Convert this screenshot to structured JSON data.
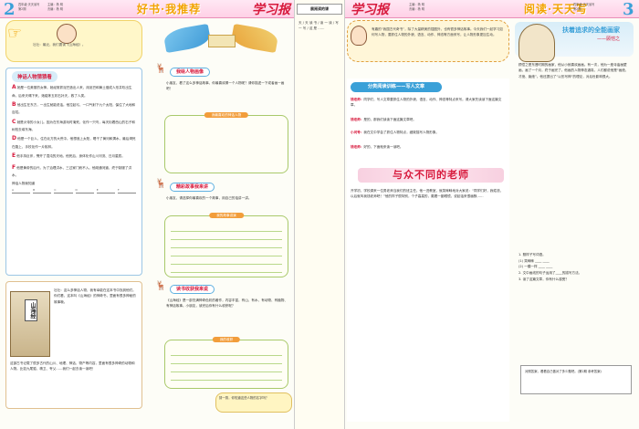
{
  "left_page": {
    "page_number": "2",
    "meta": [
      "四年级·天天读写",
      "第2期"
    ],
    "meta2": [
      "主编：杨 明",
      "责编：杨 明"
    ],
    "banner": "好书·我推荐",
    "logo": "学习报",
    "speech": "壮壮：最近，我们要读《山海经》。",
    "story_section": {
      "title": "神话人物猜猜看",
      "paragraphs": [
        {
          "lead": "A",
          "text": "她是一位美丽的女神。她经常抓泥巴造出人来，用泥巴和黄土做成人形并吹出生命。后来天塌下来，她熔炼五彩石补天，救了人类。"
        },
        {
          "lead": "B",
          "text": "他出生在东方，一出生就能说话。他拉起弓，一口气射下九个太阳，保住了大地和百姓。"
        },
        {
          "lead": "C",
          "text": "她是炎帝的小女儿。因为在东海游玩时淹死，化作一只鸟，每天衔着西山的石子和树枝去填东海。"
        },
        {
          "lead": "D",
          "text": "他是一个巨人，住在北方的大荒中。他想追上太阳，喝干了黄河和渭水，最后渴死在路上，手杖化作一片桃林。"
        },
        {
          "lead": "E",
          "text": "他手持巨斧，劈开了混沌的天地。他死后，身体化作山川河流、日月星辰。"
        },
        {
          "lead": "F",
          "text": "他是黄帝的后代，为了治理洪水，三过家门而不入。他疏通河道，终于制服了洪水。"
        }
      ],
      "summary_label": "神话人物我知道",
      "blanks": [
        "A",
        "B",
        "C",
        "D",
        "E",
        "F"
      ]
    },
    "book_section": {
      "book_title": "山海经",
      "text": "壮壮：这么多神话人物，我有幸能在这本书中找到他们。你们看，这本叫《山海经》的神奇书，里面有很多神秘的故事哦。",
      "text2": "这部古书记载了很多古代的山川、地理、神话、物产等内容，里面有很多神奇的动物和人物。比如九尾狐、精卫、夸父……我们一起去读一读吧！"
    },
    "draw_section": {
      "title": "我绘人物画像",
      "text": "小朋友，看了这么多神话故事，你最喜欢哪一个人物呢？请你描述一下或者画一画吧！",
      "frame_title": "我最喜欢的神话人物"
    },
    "story_tell": {
      "title": "精彩故事我来讲",
      "text": "小朋友，请选择你最喜欢的一个故事，用自己的话讲一讲。",
      "frame_title": "我的故事讲演"
    },
    "note_section": {
      "title": "读书收获我来说",
      "text": "《山海经》是一部充满神奇色彩的著作，内容丰富，有山、有水、有动物、有植物、有神话故事。小朋友，读完后你有什么收获呢？",
      "frame_title": "我的收获"
    },
    "girl_note": "猜一猜，你知道这些人物的名字吗？"
  },
  "gutter": {
    "title": "展阅读的课",
    "text": "天 / 天 读 书 / 读 一 读 / 写 一 写 / 这 是 ……"
  },
  "right_page": {
    "page_number": "3",
    "meta": [
      "四年级·天天读写",
      "第2期"
    ],
    "meta2": [
      "主编：杨 明",
      "责编：杨 明"
    ],
    "banner": "阅读·天天写",
    "logo": "学习报",
    "top_note": "有趣的“我国古代奇书”，除了大量精美的插图外，也有很多神话故事。今天我们一起学习如何写人物，要抓住人物的外貌、语言、动作、神态等方面来写，让人物形象更加生动。",
    "section_bar": "分类阅读训练——写人文章",
    "paragraphs": [
      {
        "lead": "钱老师：",
        "text": "同学们，写人文章要抓住人物的外貌、语言、动作、神态等特点来写。请大家先读读下面这篇文章。"
      },
      {
        "lead": "钱老师：",
        "text": "是的，那我们读读下面这篇文章吧。"
      },
      {
        "lead": "小问号：",
        "text": "我在文中学会了抓住人物特点，细致描写人物形象。"
      },
      {
        "lead": "钱老师：",
        "text": "好的，下面就来读一读吧。"
      }
    ],
    "article_title": "与众不同的老师",
    "article": "开学初，学校调来一位男老师当我们的班主任。他一进教室，就笑眯眯地对大家说：“同学们好，我姓钱，以后就叫我钱老师吧！”他的样子很特别，个子高高的，戴着一副眼镜，说起话来很幽默……",
    "side": {
      "title": "扶着追求的全能画家",
      "author": "——顾恺之",
      "text": "顾恺之是东晋时期的画家，他从小就喜欢画画。有一次，他为一座寺庙画壁画，画了一个月，终于画完了。他画的人物神态逼真，人们都说他是“画绝、才绝、痴绝”。他还提出了“以形写神”的理论，对后世影响很大。",
      "questions": "1. 照样子写词语。\n(1) 笑眯眯 ____ ____\n(2) 一模一样 ____ ____\n2. 文中画线的句子运用了____的描写方法。\n3. 读了这篇文章，你有什么感受？",
      "box": "对照答案，看看自己做对了多少题吧。(第2期 参考答案)"
    }
  }
}
